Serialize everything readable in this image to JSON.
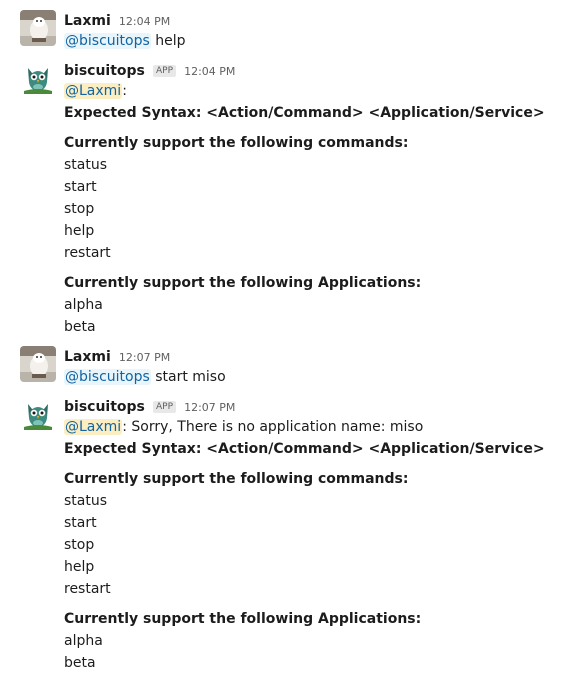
{
  "messages": [
    {
      "sender": "Laxmi",
      "time": "12:04 PM",
      "mention": "@biscuitops",
      "text": " help"
    },
    {
      "sender": "biscuitops",
      "badge": "APP",
      "time": "12:04 PM",
      "mention": "@Laxmi",
      "mention_suffix": ":",
      "syntax": "Expected Syntax: <Action/Command> <Application/Service>",
      "commands_heading": "Currently support the following commands:",
      "commands": [
        "status",
        "start",
        "stop",
        "help",
        "restart"
      ],
      "apps_heading": "Currently support the following Applications:",
      "apps": [
        "alpha",
        "beta"
      ]
    },
    {
      "sender": "Laxmi",
      "time": "12:07 PM",
      "mention": "@biscuitops",
      "text": " start miso"
    },
    {
      "sender": "biscuitops",
      "badge": "APP",
      "time": "12:07 PM",
      "mention": "@Laxmi",
      "mention_suffix": ": Sorry, There is no application name: miso",
      "syntax": "Expected Syntax: <Action/Command> <Application/Service>",
      "commands_heading": "Currently support the following commands:",
      "commands": [
        "status",
        "start",
        "stop",
        "help",
        "restart"
      ],
      "apps_heading": "Currently support the following Applications:",
      "apps": [
        "alpha",
        "beta"
      ]
    }
  ],
  "colors": {
    "mention_text": "#1264a3",
    "mention_bg": "#e8f5fa",
    "mention_self_bg": "#fbeec2",
    "timestamp": "#616061"
  },
  "icons": {
    "user_avatar": "dog-photo-avatar",
    "bot_avatar": "owl-avatar"
  }
}
